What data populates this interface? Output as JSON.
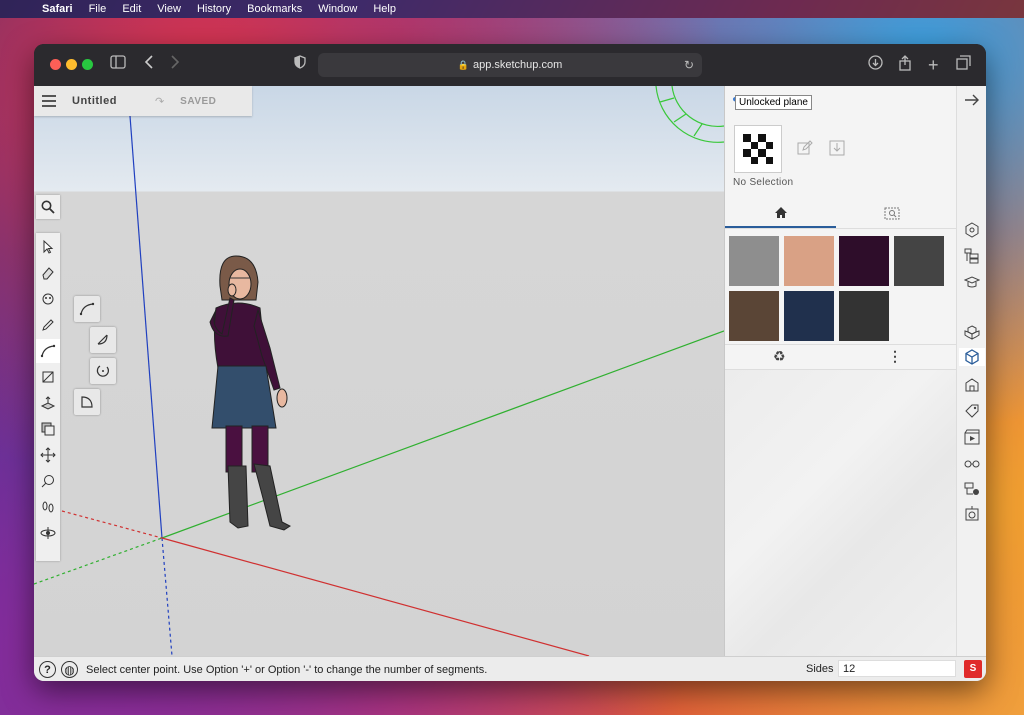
{
  "menubar": {
    "app": "Safari",
    "items": [
      "File",
      "Edit",
      "View",
      "History",
      "Bookmarks",
      "Window",
      "Help"
    ]
  },
  "browser": {
    "url": "app.sketchup.com"
  },
  "document": {
    "title": "Untitled",
    "status": "SAVED"
  },
  "tooltip": "Unlocked plane",
  "material_panel": {
    "selection_label": "No Selection",
    "swatch_colors": [
      "#8e8e8e",
      "#d9a185",
      "#2e0d2a",
      "#444444",
      "#5a4536",
      "#20304d",
      "#333333"
    ]
  },
  "statusbar": {
    "message": "Select center point. Use Option '+' or Option '-' to change the number of segments.",
    "sides_label": "Sides",
    "sides_value": "12"
  },
  "icons": {
    "sidebar_toggle": "sidebar-icon",
    "back": "chevron-left-icon",
    "forward": "chevron-right-icon",
    "privacy": "shield-icon",
    "download": "download-icon",
    "share": "share-icon",
    "new_tab": "plus-icon",
    "tabs": "tabs-overview-icon"
  },
  "colors": {
    "accent": "#2a5d9a",
    "axis_red": "#d03030",
    "axis_green": "#30b030",
    "axis_blue": "#2040c0"
  }
}
